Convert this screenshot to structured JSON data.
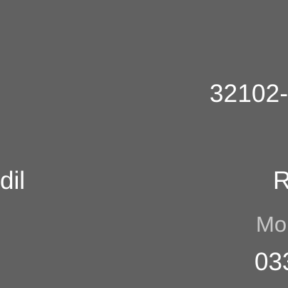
{
  "screen": {
    "top_value": "32102-",
    "left_text": "dil",
    "right_text": "R",
    "secondary_label": "Mo",
    "bottom_value": "033"
  }
}
